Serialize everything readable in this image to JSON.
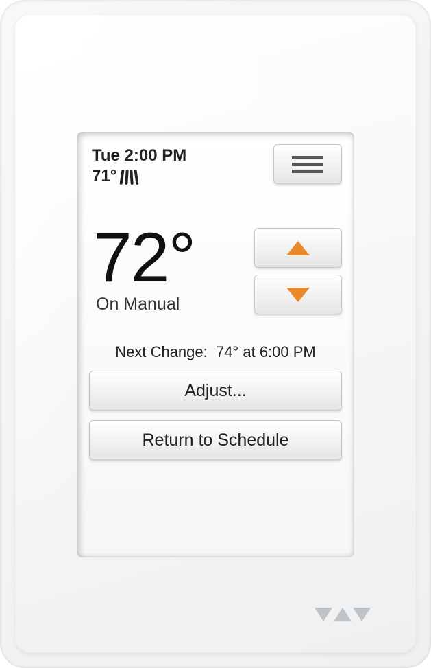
{
  "status": {
    "datetime": "Tue 2:00 PM",
    "current_temp": "71°",
    "heating_icon": "heat-waves"
  },
  "setpoint": {
    "temp": "72°",
    "mode": "On Manual"
  },
  "next_change": {
    "label": "Next Change:",
    "value": "74° at 6:00 PM"
  },
  "buttons": {
    "adjust": "Adjust...",
    "return": "Return to Schedule"
  },
  "colors": {
    "accent_arrow": "#e88a2a"
  }
}
